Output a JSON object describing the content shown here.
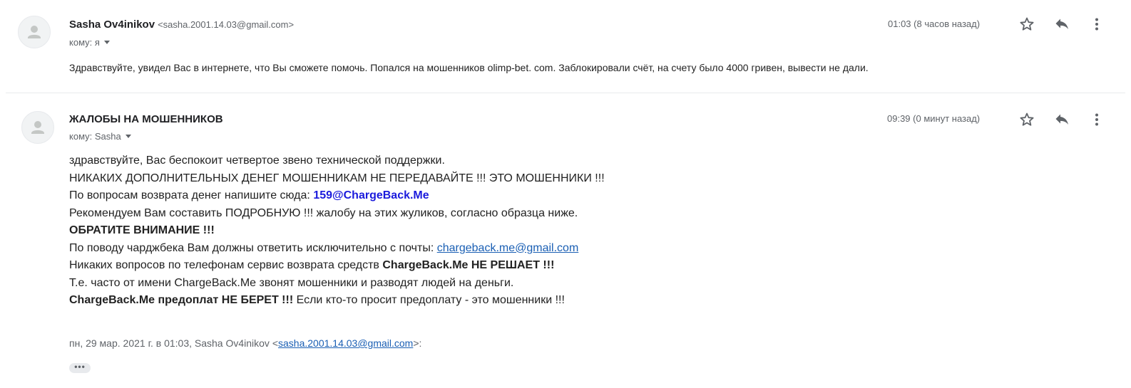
{
  "message1": {
    "sender_name": "Sasha Ov4inikov",
    "sender_email": "<sasha.2001.14.03@gmail.com>",
    "to_label": "кому: я",
    "time": "01:03 (8 часов назад)",
    "body": "Здравствуйте, увидел Вас в интернете, что Вы сможете помочь. Попался на мошенников olimp-bet. com. Заблокировали счёт, на счету было 4000 гривен, вывести не дали."
  },
  "message2": {
    "sender_name": "ЖАЛОБЫ НА МОШЕННИКОВ",
    "to_label": "кому: Sasha",
    "time": "09:39 (0 минут назад)",
    "lines": {
      "l1": "здравствуйте, Вас беспокоит четвертое звено технической поддержки.",
      "l2": "НИКАКИХ ДОПОЛНИТЕЛЬНЫХ ДЕНЕГ МОШЕННИКАМ НЕ ПЕРЕДАВАЙТЕ !!! ЭТО МОШЕННИКИ !!!",
      "l3_prefix": "По вопросам возврата денег напишите сюда: ",
      "l3_contact": "159@ChargeBack.Me",
      "l4": "Рекомендуем Вам составить ПОДРОБНУЮ !!! жалобу на этих жуликов, согласно образца ниже.",
      "l5": "ОБРАТИТЕ ВНИМАНИЕ !!!",
      "l6_prefix": "По поводу чарджбека Вам должны ответить исключительно с почты: ",
      "l6_link": "chargeback.me@gmail.com",
      "l7_prefix": "Никаких вопросов по телефонам сервис возврата средств ",
      "l7_bold": "ChargeBack.Me НЕ РЕШАЕТ !!!",
      "l8": "Т.е. часто от имени ChargeBack.Me звонят мошенники и разводят людей на деньги.",
      "l9_bold": "ChargeBack.Me предоплат НЕ БЕРЕТ !!!",
      "l9_suffix": " Если кто-то просит предоплату - это мошенники !!!"
    },
    "quote": {
      "prefix": "пн, 29 мар. 2021 г. в 01:03, Sasha Ov4inikov <",
      "email": "sasha.2001.14.03@gmail.com",
      "suffix": ">:"
    },
    "ellipsis": "•••"
  },
  "icons": {
    "avatar": "person-icon",
    "star": "star-icon",
    "reply": "reply-icon",
    "more": "more-vert-icon"
  },
  "colors": {
    "link": "#1a5fb4",
    "contact": "#1a1adc",
    "muted": "#5f6368",
    "text": "#222222"
  }
}
